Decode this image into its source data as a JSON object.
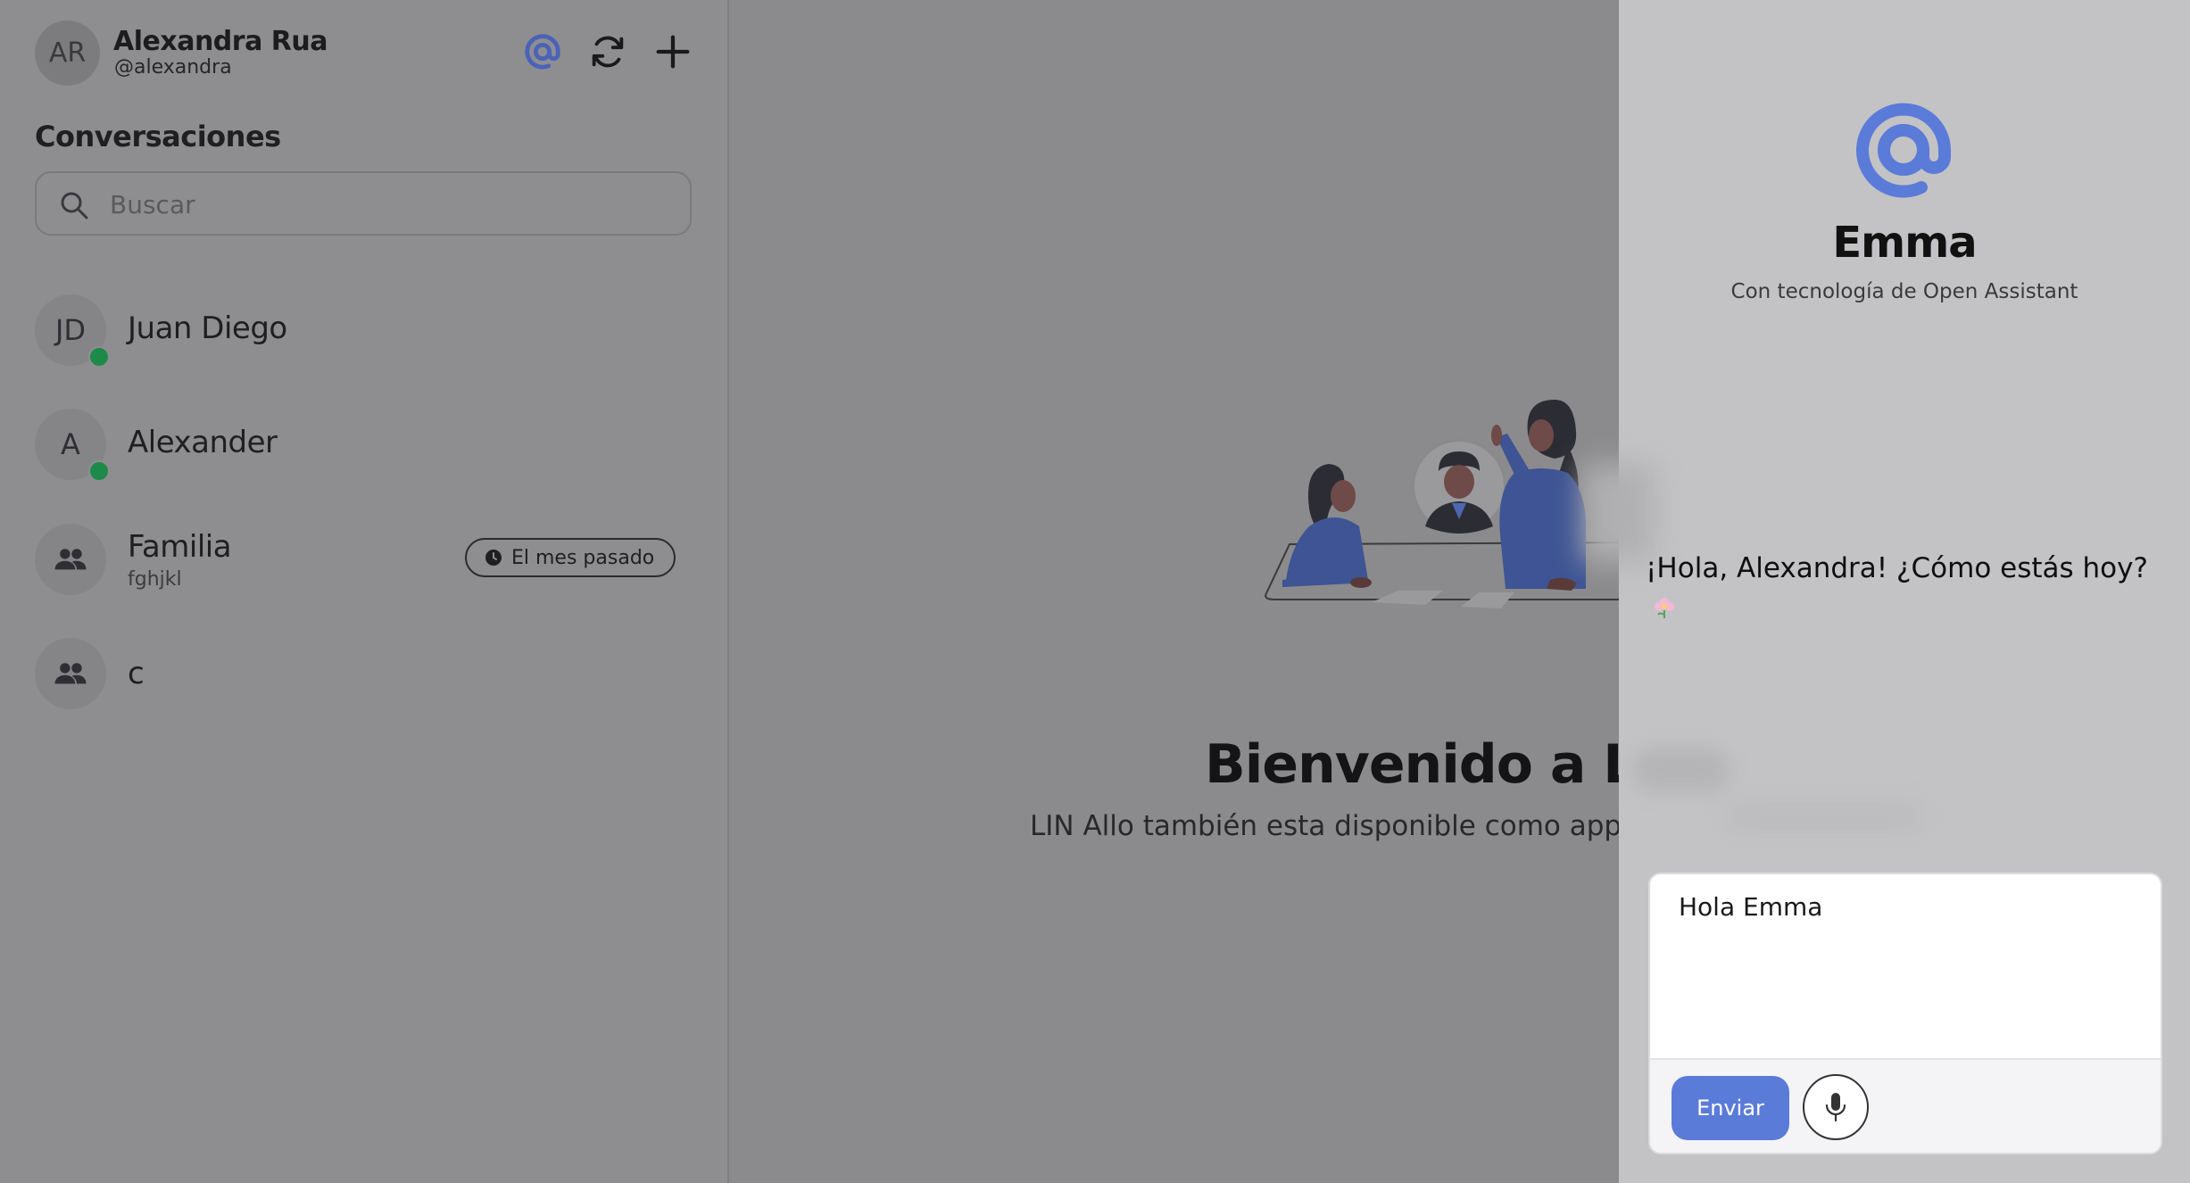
{
  "user": {
    "initials": "AR",
    "name": "Alexandra Rua",
    "handle": "@alexandra"
  },
  "header_icons": [
    "at-icon",
    "refresh-icon",
    "plus-icon"
  ],
  "sidebar": {
    "section_title": "Conversaciones",
    "search": {
      "placeholder": "Buscar",
      "value": ""
    },
    "conversations": [
      {
        "initials": "JD",
        "name": "Juan Diego",
        "online": true
      },
      {
        "initials": "A",
        "name": "Alexander",
        "online": true
      },
      {
        "name": "Familia",
        "subtitle": "fghjkl",
        "group": true,
        "time_badge": "El mes pasado"
      },
      {
        "name": "c",
        "group": true
      }
    ]
  },
  "main": {
    "welcome_title": "Bienvenido a LIN",
    "welcome_subtitle": "LIN Allo también esta disponible como app e"
  },
  "assistant": {
    "name": "Emma",
    "tagline": "Con tecnología de Open Assistant",
    "message": "¡Hola, Alexandra! ¿Cómo estás hoy?",
    "composer_value": "Hola Emma",
    "send_label": "Enviar"
  },
  "colors": {
    "accent": "#5b7bd9",
    "online": "#1e8a4a",
    "overlay": "#8b8b8d",
    "panel": "#c3c3c5"
  }
}
